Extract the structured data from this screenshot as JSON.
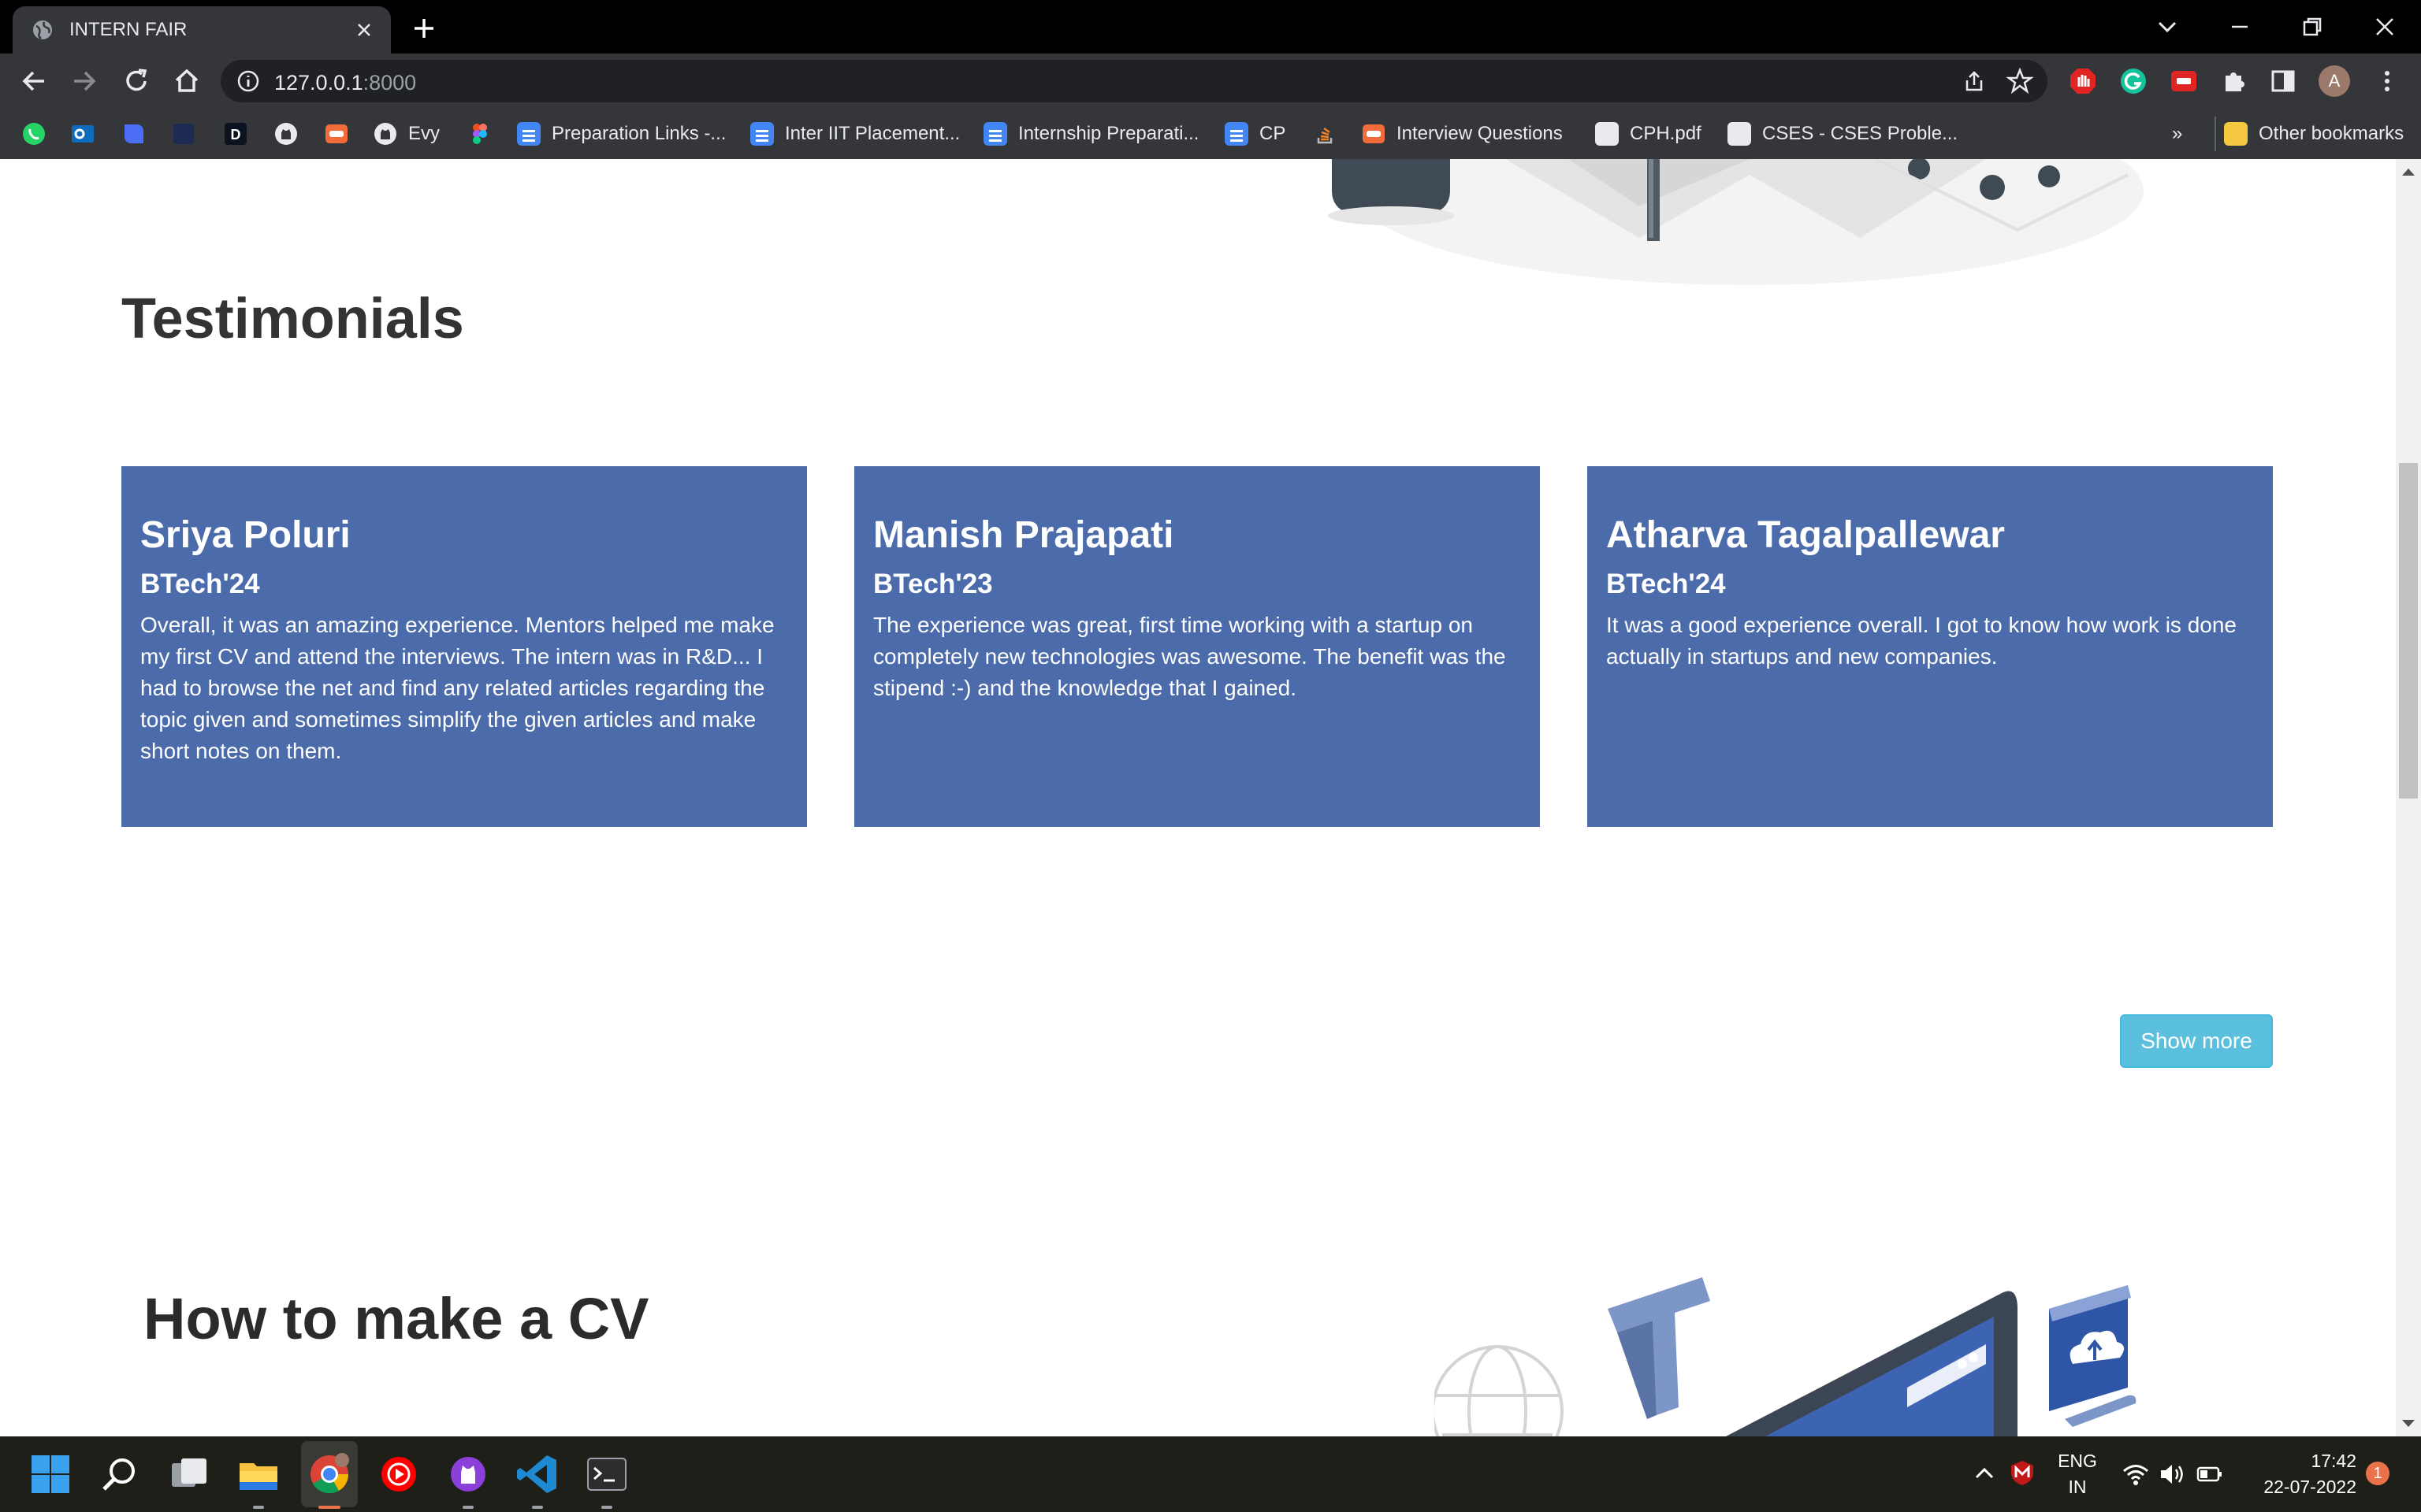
{
  "browser": {
    "tab_title": "INTERN FAIR",
    "url_host": "127.0.0.1",
    "url_port": ":8000",
    "profile_initial": "A",
    "bookmarks": [
      {
        "label": "",
        "icon": "whatsapp-icon"
      },
      {
        "label": "",
        "icon": "outlook-icon"
      },
      {
        "label": "",
        "icon": "bookmark-app-icon"
      },
      {
        "label": "",
        "icon": "dark-app-icon"
      },
      {
        "label": "",
        "icon": "d-icon"
      },
      {
        "label": "",
        "icon": "github-icon"
      },
      {
        "label": "",
        "icon": "codechef-icon"
      },
      {
        "label": "Evy",
        "icon": "github-icon"
      },
      {
        "label": "",
        "icon": "figma-icon"
      },
      {
        "label": "Preparation Links -...",
        "icon": "google-docs-icon"
      },
      {
        "label": "Inter IIT Placement...",
        "icon": "google-docs-icon"
      },
      {
        "label": "Internship Preparati...",
        "icon": "google-docs-icon"
      },
      {
        "label": "CP",
        "icon": "google-docs-icon"
      },
      {
        "label": "",
        "icon": "stackoverflow-icon"
      },
      {
        "label": "Interview Questions",
        "icon": "codechef-icon"
      },
      {
        "label": "CPH.pdf",
        "icon": "globe-icon"
      },
      {
        "label": "CSES - CSES Proble...",
        "icon": "globe-icon"
      }
    ],
    "overflow_label": "»",
    "other_bookmarks": "Other bookmarks"
  },
  "page": {
    "testimonials_title": "Testimonials",
    "testimonials": [
      {
        "name": "Sriya Poluri",
        "batch": "BTech'24",
        "text": "Overall, it was an amazing experience. Mentors helped me make my first CV and attend the interviews. The intern was in R&D... I had to browse the net and find any related articles regarding the topic given and sometimes simplify the given articles and make short notes on them."
      },
      {
        "name": "Manish Prajapati",
        "batch": "BTech'23",
        "text": "The experience was great, first time working with a startup on completely new technologies was awesome. The benefit was the stipend :-) and the knowledge that I gained."
      },
      {
        "name": "Atharva Tagalpallewar",
        "batch": "BTech'24",
        "text": "It was a good experience overall. I got to know how work is done actually in startups and new companies."
      }
    ],
    "show_more_label": "Show more",
    "cv_title": "How to make a CV"
  },
  "colors": {
    "card_bg": "#4b6baa",
    "show_more_bg": "#5bc0de",
    "chrome_bg": "#35363a"
  },
  "taskbar": {
    "lang_line1": "ENG",
    "lang_line2": "IN",
    "time": "17:42",
    "date": "22-07-2022",
    "notification_count": "1"
  }
}
